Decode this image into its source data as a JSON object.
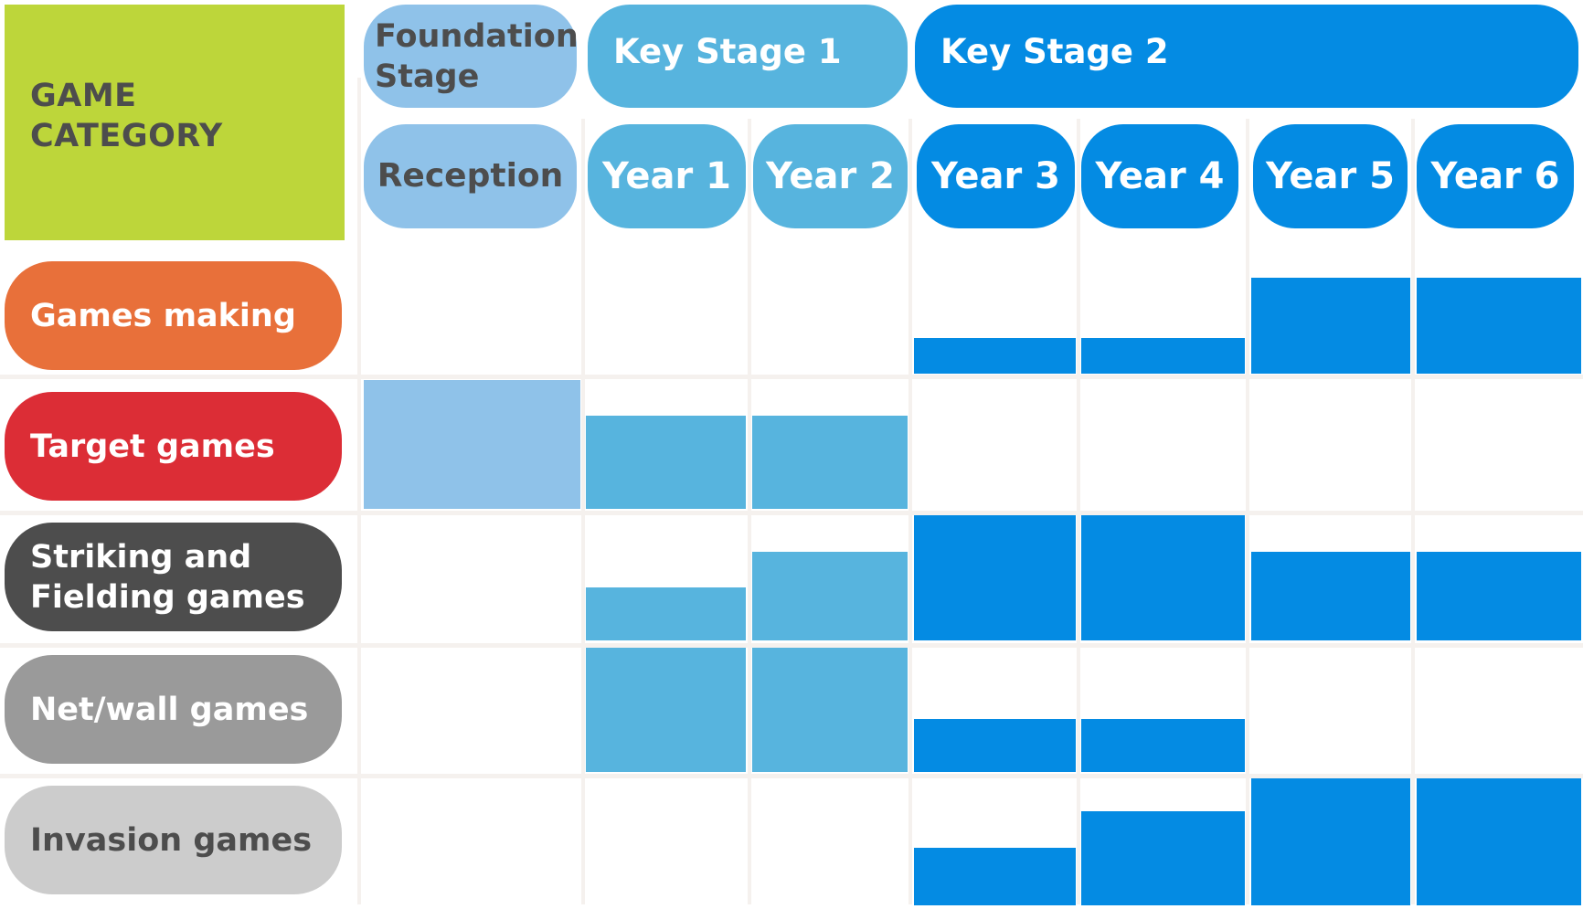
{
  "chart_data": {
    "type": "heatmap",
    "title": "GAME CATEGORY",
    "stage_groups": [
      {
        "label": "Foundation Stage",
        "columns": [
          "Reception"
        ],
        "color": "#8fc2e9",
        "text_color": "#4d4d4d"
      },
      {
        "label": "Key Stage 1",
        "columns": [
          "Year 1",
          "Year 2"
        ],
        "color": "#57b4de",
        "text_color": "#ffffff"
      },
      {
        "label": "Key Stage 2",
        "columns": [
          "Year 3",
          "Year 4",
          "Year 5",
          "Year 6"
        ],
        "color": "#048be3",
        "text_color": "#ffffff"
      }
    ],
    "columns": [
      {
        "label": "Reception",
        "group": 0
      },
      {
        "label": "Year 1",
        "group": 1
      },
      {
        "label": "Year 2",
        "group": 1
      },
      {
        "label": "Year 3",
        "group": 2
      },
      {
        "label": "Year 4",
        "group": 2
      },
      {
        "label": "Year 5",
        "group": 2
      },
      {
        "label": "Year 6",
        "group": 2
      }
    ],
    "rows": [
      {
        "label": "Games making",
        "color": "#e8703a",
        "text_color": "#ffffff",
        "values": [
          0,
          0,
          0,
          0.25,
          0.25,
          0.68,
          0.68
        ]
      },
      {
        "label": "Target games",
        "color": "#dc2d36",
        "text_color": "#ffffff",
        "values": [
          1.0,
          0.72,
          0.72,
          0,
          0,
          0,
          0
        ]
      },
      {
        "label": "Striking and\nFielding games",
        "color": "#4d4d4d",
        "text_color": "#ffffff",
        "values": [
          0,
          0.42,
          0.71,
          1.0,
          1.0,
          0.71,
          0.71
        ]
      },
      {
        "label": "Net/wall games",
        "color": "#9a9a9a",
        "text_color": "#ffffff",
        "values": [
          0,
          1.0,
          1.0,
          0.43,
          0.43,
          0,
          0
        ]
      },
      {
        "label": "Invasion games",
        "color": "#cccccc",
        "text_color": "#4d4d4d",
        "values": [
          0,
          0,
          0,
          0.45,
          0.74,
          1.0,
          1.0
        ]
      }
    ],
    "value_scale": "fraction of cell height (relative emphasis)",
    "grid": true,
    "legend": "none"
  },
  "header": {
    "title_line1": "GAME",
    "title_line2": "CATEGORY",
    "title_color": "#bdd63a"
  }
}
